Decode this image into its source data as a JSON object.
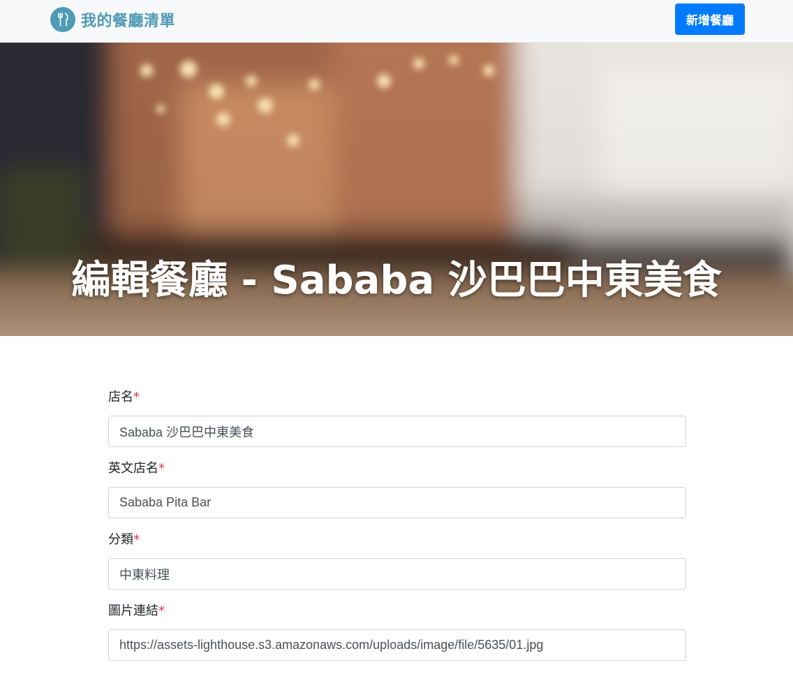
{
  "navbar": {
    "brand_text": "我的餐廳清單",
    "brand_icon": "utensils-icon",
    "add_button_label": "新增餐廳"
  },
  "banner": {
    "title": "編輯餐廳 - Sababa 沙巴巴中東美食"
  },
  "form": {
    "required_mark": "*",
    "fields": [
      {
        "label": "店名",
        "value": "Sababa 沙巴巴中東美食"
      },
      {
        "label": "英文店名",
        "value": "Sababa Pita Bar"
      },
      {
        "label": "分類",
        "value": "中東料理"
      },
      {
        "label": "圖片連結",
        "value": "https://assets-lighthouse.s3.amazonaws.com/uploads/image/file/5635/01.jpg"
      }
    ]
  },
  "colors": {
    "brand": "#4f9bb5",
    "primary_button": "#007bff",
    "required": "#dc3545",
    "navbar_bg": "#f8f9fa"
  }
}
